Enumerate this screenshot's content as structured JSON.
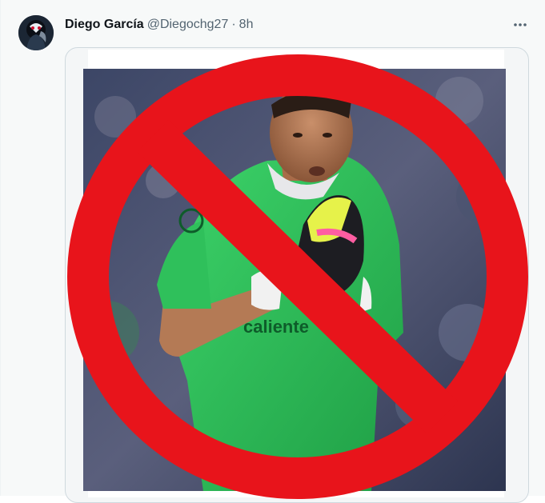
{
  "tweet": {
    "author": {
      "display_name": "Diego García",
      "handle": "@Diegochg27",
      "separator": "·",
      "time": "8h"
    },
    "photo": {
      "jersey_text": "caliente"
    }
  },
  "colors": {
    "name": "#0f1419",
    "secondary": "#536471",
    "ban_red": "#e8141b",
    "jersey_green": "#2fc05b"
  },
  "icons": {
    "more": "more-horizontal-icon"
  }
}
